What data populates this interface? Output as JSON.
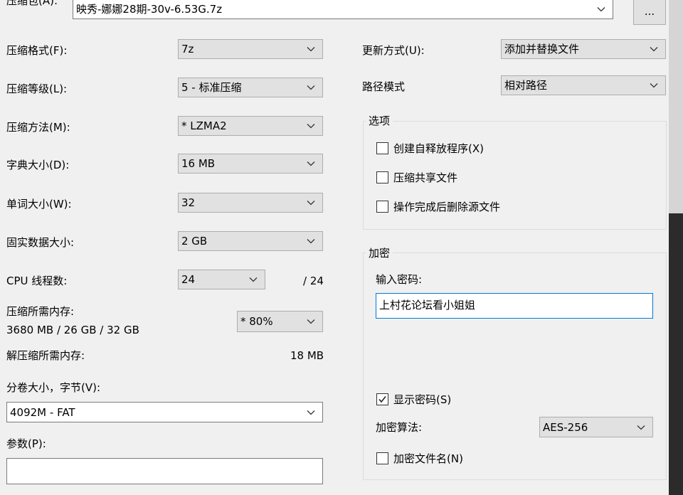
{
  "archive": {
    "label": "压缩包(A):",
    "path": "映秀-娜娜28期-30v-6.53G.7z",
    "browse_label": "..."
  },
  "left": {
    "format": {
      "label": "压缩格式(F):",
      "value": "7z"
    },
    "level": {
      "label": "压缩等级(L):",
      "value": "5 - 标准压缩"
    },
    "method": {
      "label": "压缩方法(M):",
      "value": "* LZMA2"
    },
    "dict": {
      "label": "字典大小(D):",
      "value": "16 MB"
    },
    "word": {
      "label": "单词大小(W):",
      "value": "32"
    },
    "solid": {
      "label": "固实数据大小:",
      "value": "2 GB"
    },
    "threads": {
      "label": "CPU 线程数:",
      "value": "24",
      "total": "/ 24"
    },
    "memory": {
      "label": "压缩所需内存:",
      "detail": "3680 MB / 26 GB / 32 GB",
      "value": "* 80%"
    },
    "decompress_mem": {
      "label": "解压缩所需内存:",
      "value": "18 MB"
    },
    "volume": {
      "label": "分卷大小，字节(V):",
      "value": "4092M - FAT"
    },
    "params": {
      "label": "参数(P):",
      "value": ""
    }
  },
  "right": {
    "update": {
      "label": "更新方式(U):",
      "value": "添加并替换文件"
    },
    "pathmode": {
      "label": "路径模式",
      "value": "相对路径"
    },
    "options": {
      "title": "选项",
      "sfx": {
        "label": "创建自释放程序(X)",
        "checked": false
      },
      "shared": {
        "label": "压缩共享文件",
        "checked": false
      },
      "delete": {
        "label": "操作完成后删除源文件",
        "checked": false
      }
    },
    "encryption": {
      "title": "加密",
      "password_label": "输入密码:",
      "password": "上村花论坛看小姐姐",
      "show_password": {
        "label": "显示密码(S)",
        "checked": true
      },
      "method_label": "加密算法:",
      "method": "AES-256",
      "encrypt_names": {
        "label": "加密文件名(N)",
        "checked": false
      }
    }
  }
}
